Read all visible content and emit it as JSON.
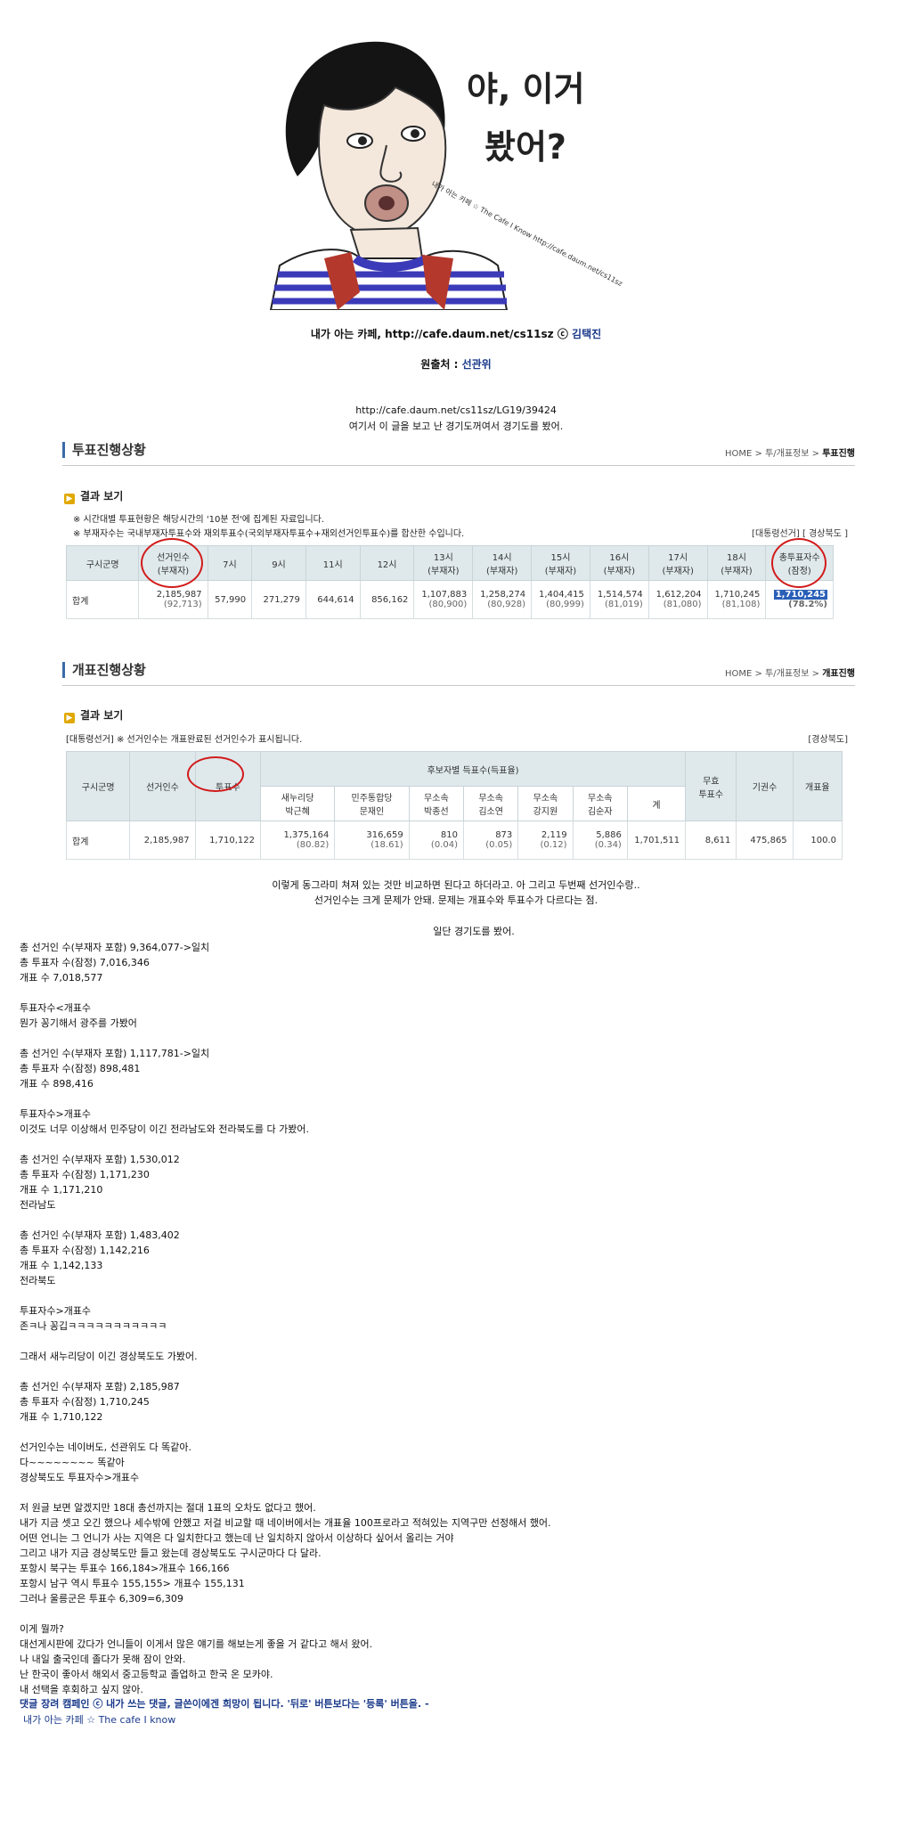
{
  "hero": {
    "bubble_line1": "야, 이거",
    "bubble_line2": "봤어?",
    "watermark": "내가 아는 카페 ☆ The Cafe I Know http://cafe.daum.net/cs11sz"
  },
  "credit": {
    "cafe": "내가 아는 카페, http://cafe.daum.net/cs11sz ",
    "symbol": "ⓒ",
    "author": "김택진"
  },
  "source": {
    "label": "원출처 : ",
    "name": "선관위"
  },
  "url": "http://cafe.daum.net/cs11sz/LG19/39424",
  "url_note": "여기서 이 글을 보고 난 경기도꺼여서 경기도를 봤어.",
  "vote_panel": {
    "title": "투표진행상황",
    "crumb_home": "HOME",
    "crumb_mid": "투/개표정보",
    "crumb_current": "투표진행",
    "result_label": "결과 보기",
    "note1": "※ 시간대별 투표현황은 해당시간의 '10분 전'에 집계된 자료입니다.",
    "note2": "※ 부재자수는 국내부재자투표수와 재외투표수(국외부재자투표수+재외선거인투표수)를 합산한 수입니다.",
    "filter": "[대통령선거] [ 경상북도 ]",
    "headers": [
      "구시군명",
      "선거인수",
      "7시",
      "9시",
      "11시",
      "12시",
      "13시",
      "14시",
      "15시",
      "16시",
      "17시",
      "18시",
      "총투표자수"
    ],
    "subheaders": [
      "",
      "(부재자)",
      "",
      "",
      "",
      "",
      "(부재자)",
      "(부재자)",
      "(부재자)",
      "(부재자)",
      "(부재자)",
      "(부재자)",
      "(잠정)"
    ],
    "row_label": "합계",
    "row_main": [
      "2,185,987",
      "57,990",
      "271,279",
      "644,614",
      "856,162",
      "1,107,883",
      "1,258,274",
      "1,404,415",
      "1,514,574",
      "1,612,204",
      "1,710,245",
      "1,710,245"
    ],
    "row_sub": [
      "(92,713)",
      "",
      "",
      "",
      "",
      "(80,900)",
      "(80,928)",
      "(80,999)",
      "(81,019)",
      "(81,080)",
      "(81,108)",
      "(78.2%)"
    ]
  },
  "count_panel": {
    "title": "개표진행상황",
    "crumb_home": "HOME",
    "crumb_mid": "투/개표정보",
    "crumb_current": "개표진행",
    "result_label": "결과 보기",
    "note": "[대통령선거] ※ 선거인수는 개표완료된 선거인수가 표시됩니다.",
    "filter": "[경상북도]",
    "h_region": "구시군명",
    "h_voters": "선거인수",
    "h_ballots": "투표수",
    "h_candidates": "후보자별 득표수(득표율)",
    "h_invalid": "무효\n투표수",
    "h_abstain": "기권수",
    "h_rate": "개표율",
    "candidates": [
      {
        "party": "새누리당",
        "name": "박근혜"
      },
      {
        "party": "민주통합당",
        "name": "문재인"
      },
      {
        "party": "무소속",
        "name": "박종선"
      },
      {
        "party": "무소속",
        "name": "김소연"
      },
      {
        "party": "무소속",
        "name": "강지원"
      },
      {
        "party": "무소속",
        "name": "김순자"
      }
    ],
    "h_total": "계",
    "row_label": "합계",
    "voters": "2,185,987",
    "ballots": "1,710,122",
    "votes": [
      {
        "v": "1,375,164",
        "p": "(80.82)"
      },
      {
        "v": "316,659",
        "p": "(18.61)"
      },
      {
        "v": "810",
        "p": "(0.04)"
      },
      {
        "v": "873",
        "p": "(0.05)"
      },
      {
        "v": "2,119",
        "p": "(0.12)"
      },
      {
        "v": "5,886",
        "p": "(0.34)"
      }
    ],
    "total": "1,701,511",
    "invalid": "8,611",
    "abstain": "475,865",
    "rate": "100.0"
  },
  "after_table": [
    "이렇게 동그라미 쳐져 있는 것만 비교하면 된다고 하더라고. 아 그리고 두번째 선거인수랑..",
    "선거인수는 크게 문제가 안돼. 문제는 개표수와 투표수가 다르다는 점."
  ],
  "center_line": "일단 경기도를 봤어.",
  "body": [
    "총 선거인 수(부재자 포함) 9,364,077->일치",
    "총 투표자 수(잠정) 7,016,346",
    "개표 수 7,018,577",
    "",
    "투표자수<개표수",
    "뭔가 꽁기해서 광주를 가봤어",
    "",
    "총 선거인 수(부재자 포함) 1,117,781->일치",
    "총 투표자 수(잠정) 898,481",
    "개표 수 898,416",
    "",
    "투표자수>개표수",
    "이것도 너무 이상해서 민주당이 이긴 전라남도와 전라북도를 다 가봤어.",
    "",
    "총 선거인 수(부재자 포함) 1,530,012",
    "총 투표자 수(잠정) 1,171,230",
    "개표 수 1,171,210",
    "전라남도",
    "",
    "총 선거인 수(부재자 포함) 1,483,402",
    "총 투표자 수(잠정) 1,142,216",
    "개표 수 1,142,133",
    "전라북도",
    "",
    "투표자수>개표수",
    "존ㅋ나 꽁깁ㅋㅋㅋㅋㅋㅋㅋㅋㅋㅋㅋ",
    "",
    "그래서 새누리당이 이긴 경상북도도 가봤어.",
    "",
    "총 선거인 수(부재자 포함) 2,185,987",
    "총 투표자 수(잠정) 1,710,245",
    "개표 수 1,710,122",
    "",
    "선거인수는 네이버도, 선관위도 다 똑같아.",
    "다~~~~~~~~ 똑같아",
    "경상북도도 투표자수>개표수",
    "",
    "저 원글 보면 알겠지만 18대 총선까지는 절대 1표의 오차도 없다고 했어.",
    "내가 지금 셋고 오긴 했으나 세수밖에 안했고 저걸 비교할 때 네이버에서는 개표율 100프로라고 적혀있는 지역구만 선정해서 했어.",
    "어떤 언니는 그 언니가 사는 지역은 다 일치한다고 했는데 난 일치하지 않아서 이상하다 싶어서 올리는 거야",
    "그리고 내가 지금 경상북도만 들고 왔는데 경상북도도 구시군마다 다 달라.",
    "포항시 북구는 투표수 166,184>개표수 166,166",
    "포항시 남구 역시 투표수 155,155> 개표수 155,131",
    "그러나 울릉군은 투표수 6,309=6,309",
    "",
    "이게 뭘까?",
    "대선게시판에 갔다가 언니들이 이게서 많은 얘기를 해보는게 좋을 거 같다고 해서 왔어.",
    "나 내일 출국인데 졸다가 못해 잠이 안와.",
    "난 한국이 좋아서 해외서 중고등학교 졸업하고 한국 온 모카야.",
    "내 선택을 후회하고 싶지 않아."
  ],
  "footer": {
    "line1": "댓글 장려 캠페인 ⓒ 내가 쓰는 댓글, 글쓴이에겐 희망이 됩니다. '뒤로' 버튼보다는 '등록' 버튼을. -",
    "line2": "내가 아는 카페 ☆ The cafe I know"
  },
  "colors": {
    "header_bg": "#dfe9ec",
    "highlight": "#2a5fb8",
    "circle": "#d21b1b",
    "link": "#1a3a8a"
  }
}
